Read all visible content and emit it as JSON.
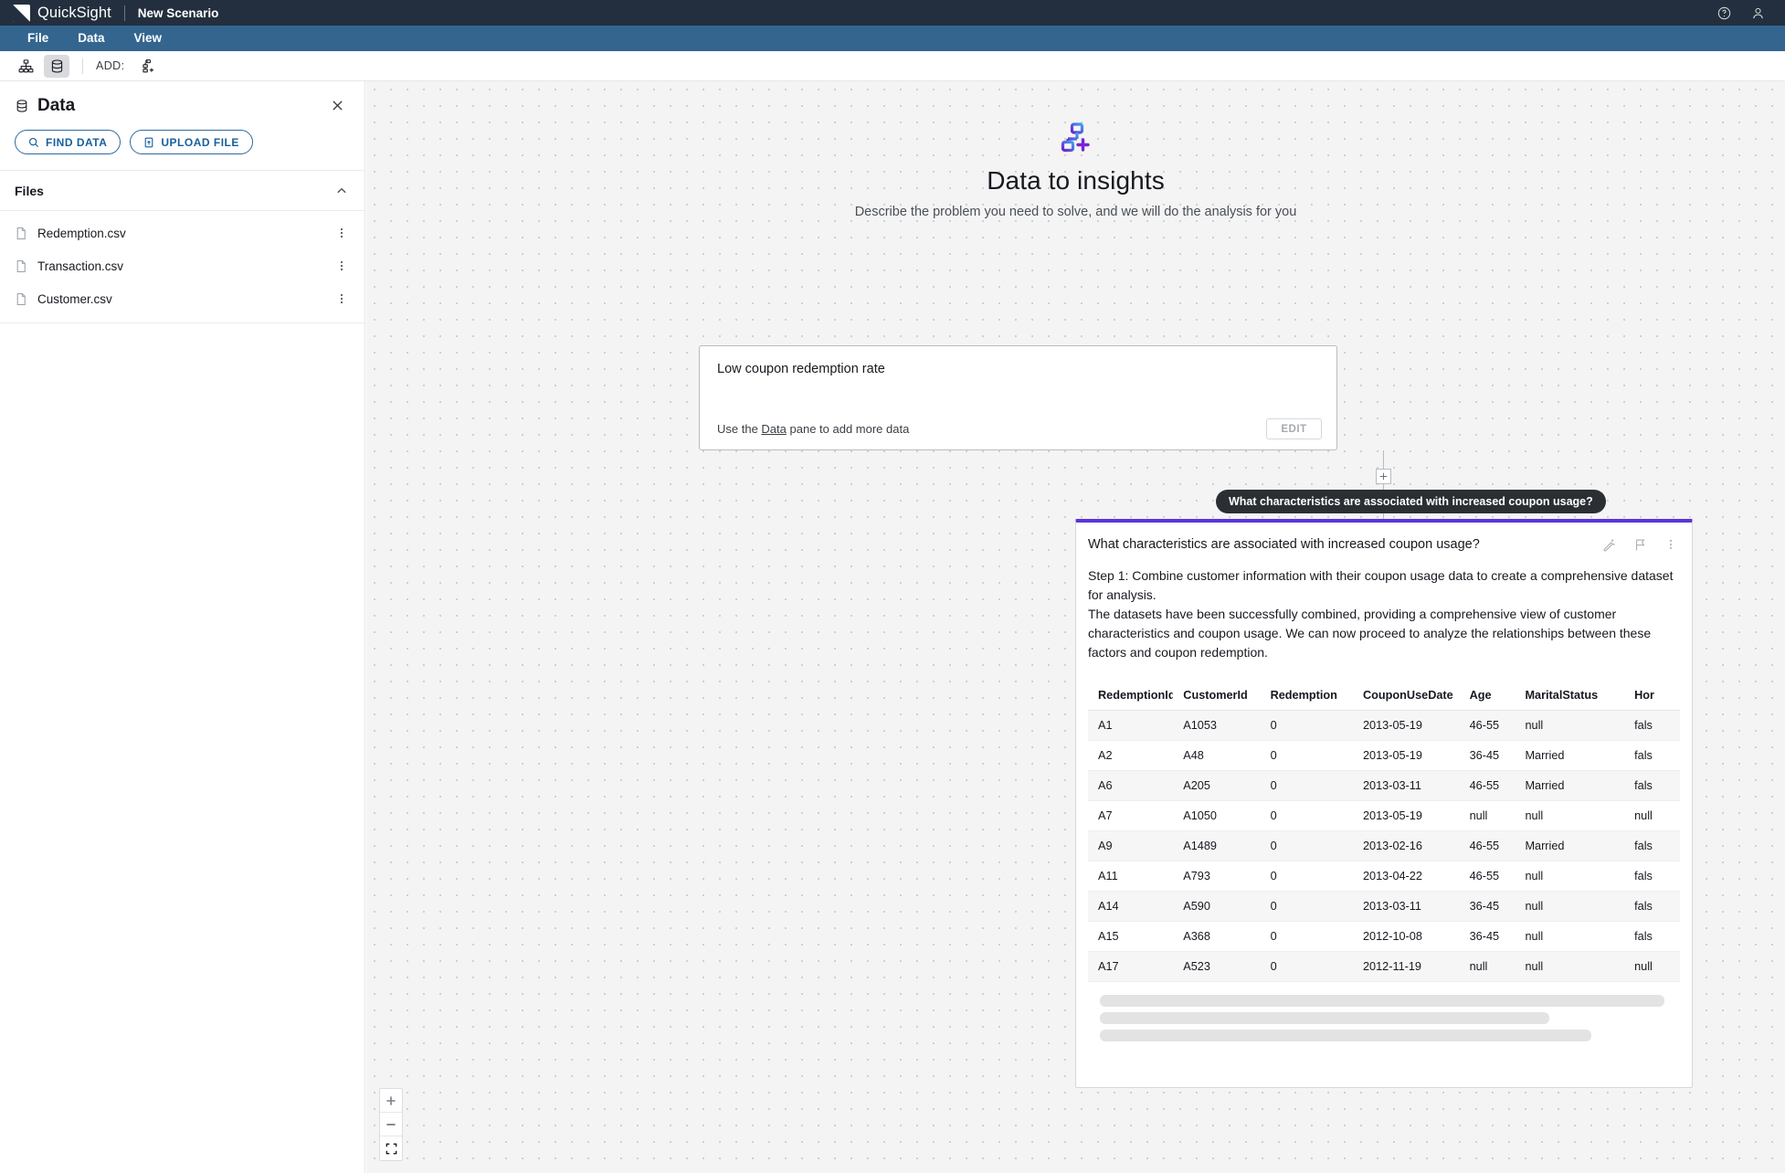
{
  "app": {
    "brand": "QuickSight",
    "scenario_name": "New Scenario",
    "help_icon": "question-circle-icon",
    "account_icon": "user-icon"
  },
  "menubar": {
    "items": [
      "File",
      "Data",
      "View"
    ]
  },
  "toolbar": {
    "flow_view_icon": "sitemap-icon",
    "data_view_icon": "database-icon",
    "add_label": "ADD:",
    "add_node_icon": "add-node-icon"
  },
  "sidebar": {
    "title": "Data",
    "title_icon": "database-icon",
    "close_icon": "close-icon",
    "find_data_label": "FIND DATA",
    "find_data_icon": "search-icon",
    "upload_file_label": "UPLOAD FILE",
    "upload_file_icon": "upload-icon",
    "section": {
      "title": "Files",
      "collapse_icon": "chevron-up-icon",
      "items": [
        {
          "name": "Redemption.csv",
          "icon": "file-icon",
          "menu_icon": "kebab-icon"
        },
        {
          "name": "Transaction.csv",
          "icon": "file-icon",
          "menu_icon": "kebab-icon"
        },
        {
          "name": "Customer.csv",
          "icon": "file-icon",
          "menu_icon": "kebab-icon"
        }
      ]
    }
  },
  "canvas": {
    "hero": {
      "icon": "data-to-insights-icon",
      "title": "Data to insights",
      "subtitle": "Describe the problem you need to solve, and we will do the analysis for you"
    },
    "problem_card": {
      "text": "Low coupon redemption rate",
      "hint_prefix": "Use the ",
      "hint_link": "Data",
      "hint_suffix": " pane to add more data",
      "edit_label": "EDIT"
    },
    "connector": {
      "plus_icon": "plus-icon"
    },
    "tooltip": "What characteristics are associated with increased coupon usage?",
    "analysis_card": {
      "accent_color": "#5b36d9",
      "title": "What characteristics are associated with increased coupon usage?",
      "icons": [
        "magic-wand-icon",
        "flag-icon",
        "kebab-icon"
      ],
      "step_text": "Step 1: Combine customer information with their coupon usage data to create a comprehensive dataset for analysis.",
      "result_text": "The datasets have been successfully combined, providing a comprehensive view of customer characteristics and coupon usage. We can now proceed to analyze the relationships between these factors and coupon redemption.",
      "table": {
        "columns": [
          "RedemptionId",
          "CustomerId",
          "Redemption",
          "CouponUseDate",
          "Age",
          "MaritalStatus",
          "Hor"
        ],
        "rows": [
          [
            "A1",
            "A1053",
            "0",
            "2013-05-19",
            "46-55",
            "null",
            "fals"
          ],
          [
            "A2",
            "A48",
            "0",
            "2013-05-19",
            "36-45",
            "Married",
            "fals"
          ],
          [
            "A6",
            "A205",
            "0",
            "2013-03-11",
            "46-55",
            "Married",
            "fals"
          ],
          [
            "A7",
            "A1050",
            "0",
            "2013-05-19",
            "null",
            "null",
            "null"
          ],
          [
            "A9",
            "A1489",
            "0",
            "2013-02-16",
            "46-55",
            "Married",
            "fals"
          ],
          [
            "A11",
            "A793",
            "0",
            "2013-04-22",
            "46-55",
            "null",
            "fals"
          ],
          [
            "A14",
            "A590",
            "0",
            "2013-03-11",
            "36-45",
            "null",
            "fals"
          ],
          [
            "A15",
            "A368",
            "0",
            "2012-10-08",
            "36-45",
            "null",
            "fals"
          ],
          [
            "A17",
            "A523",
            "0",
            "2012-11-19",
            "null",
            "null",
            "null"
          ]
        ]
      },
      "loading_bar_widths": [
        "618px",
        "492px",
        "538px"
      ]
    },
    "zoom_controls": {
      "zoom_in_icon": "plus-icon",
      "zoom_out_icon": "minus-icon",
      "fit_icon": "fit-screen-icon"
    }
  }
}
